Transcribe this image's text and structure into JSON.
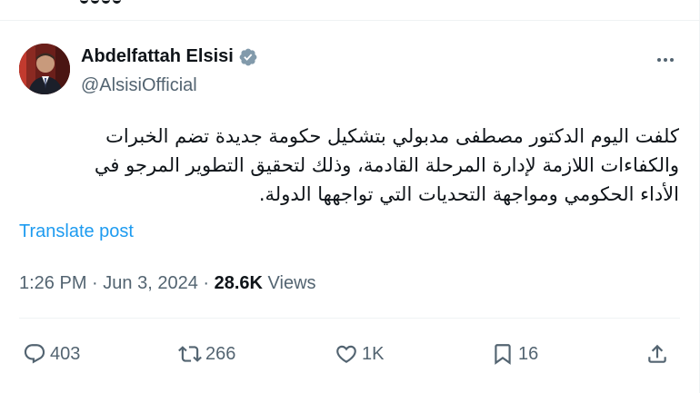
{
  "author": {
    "display_name": "Abdelfattah Elsisi",
    "handle": "@AlsisiOfficial",
    "verified": true
  },
  "post": {
    "text": "كلفت اليوم الدكتور مصطفى مدبولي بتشكيل حكومة جديدة تضم الخبرات\nوالكفاءات اللازمة لإدارة المرحلة القادمة، وذلك لتحقيق التطوير المرجو في\nالأداء الحكومي ومواجهة التحديات التي تواجهها الدولة.",
    "translate_label": "Translate post",
    "time": "1:26 PM",
    "date": "Jun 3, 2024",
    "separator": "·",
    "views_count": "28.6K",
    "views_label": "Views"
  },
  "actions": {
    "replies": "403",
    "reposts": "266",
    "likes": "1K",
    "bookmarks": "16"
  },
  "icons": {
    "more": "more-horizontal-icon",
    "reply": "reply-bubble-icon",
    "repost": "repost-arrows-icon",
    "like": "heart-icon",
    "bookmark": "bookmark-icon",
    "share": "share-upload-icon",
    "verified": "verified-badge-icon"
  },
  "colors": {
    "accent": "#1d9bf0",
    "text_primary": "#0f1419",
    "text_secondary": "#536471",
    "divider": "#eff3f4",
    "verified_badge": "#829aab"
  }
}
